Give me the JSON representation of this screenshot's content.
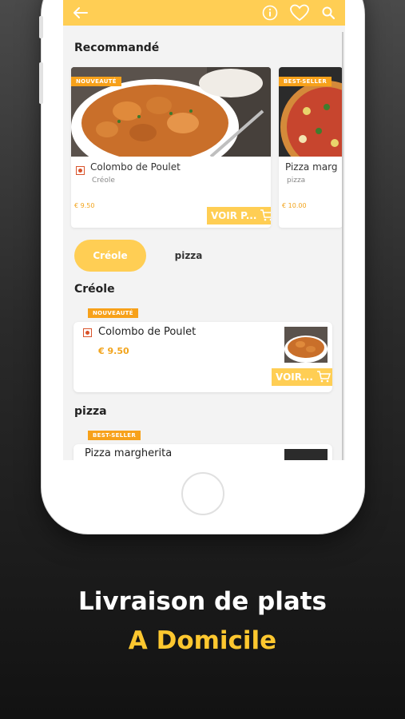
{
  "appbar": {
    "back_icon": "arrow-left-icon",
    "info_icon": "info-icon",
    "favorite_icon": "heart-icon",
    "search_icon": "search-icon",
    "color": "#ffce54"
  },
  "recommended": {
    "title": "Recommandé",
    "cards": [
      {
        "badge": "NOUVEAUTÉ",
        "name": "Colombo de Poulet",
        "category": "Créole",
        "price": "€ 9.50",
        "button": "VOIR P..."
      },
      {
        "badge": "BEST-SELLER",
        "name": "Pizza marg",
        "category": "pizza",
        "price": "€ 10.00"
      }
    ]
  },
  "filters": {
    "items": [
      "Créole",
      "pizza"
    ],
    "selected": "Créole"
  },
  "sections": [
    {
      "title": "Créole",
      "item": {
        "badge": "NOUVEAUTÉ",
        "name": "Colombo de Poulet",
        "price": "€ 9.50",
        "button": "VOIR..."
      }
    },
    {
      "title": "pizza",
      "item": {
        "badge": "BEST-SELLER",
        "name": "Pizza margherita"
      }
    }
  ],
  "caption": {
    "line1": "Livraison de plats",
    "line2": "A Domicile"
  },
  "colors": {
    "accent": "#ffce54",
    "badge": "#f7a11a",
    "price": "#f2a41c",
    "caption_highlight": "#fdc72f"
  }
}
